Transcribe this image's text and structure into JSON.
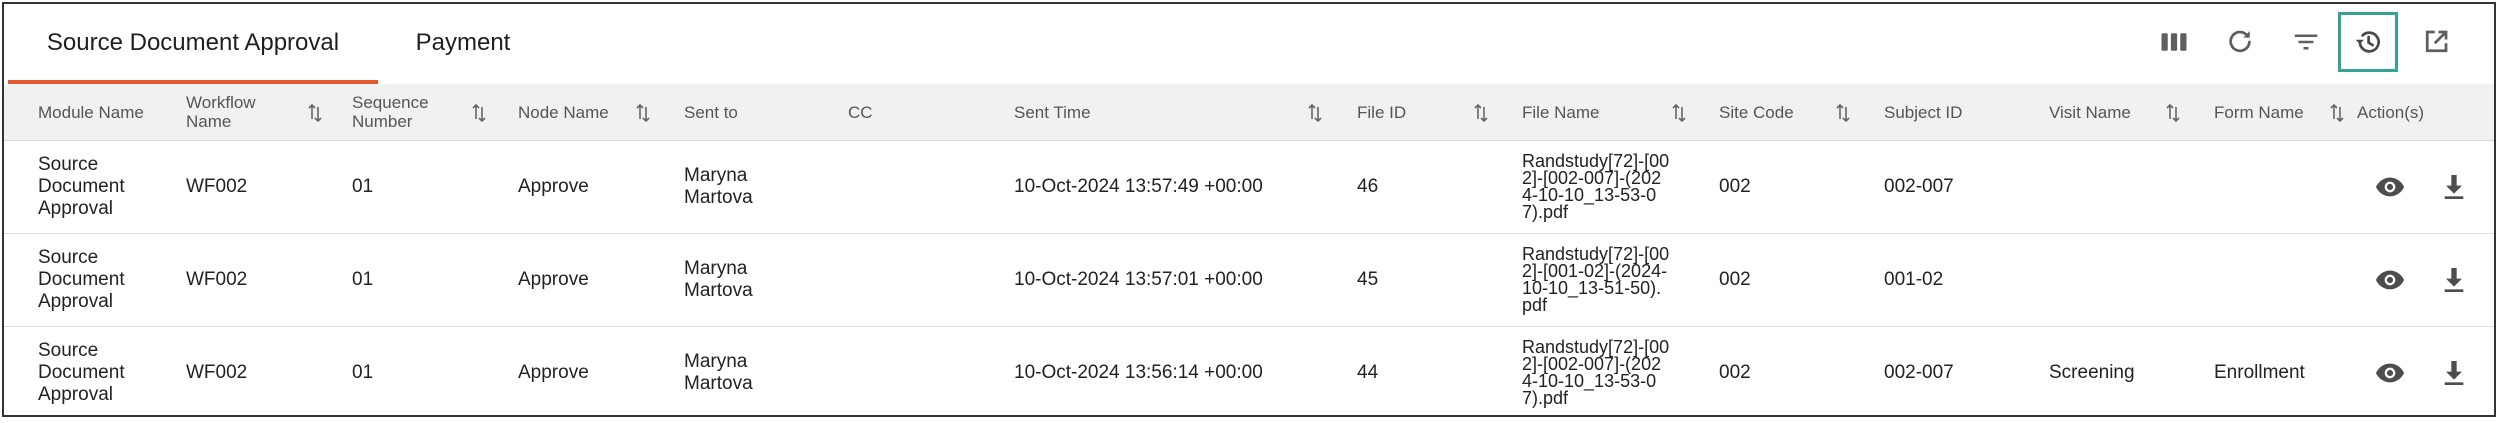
{
  "tabs": [
    {
      "label": "Source Document Approval",
      "active": true
    },
    {
      "label": "Payment",
      "active": false
    }
  ],
  "toolbar": {
    "icons": [
      "columns-icon",
      "refresh-icon",
      "filter-icon",
      "history-icon",
      "open-external-icon"
    ],
    "selected": "history-icon",
    "selected_color": "#36a392"
  },
  "accent_color": "#e2592f",
  "table": {
    "headers": [
      "Module Name",
      "Workflow Name",
      "Sequence Number",
      "Node Name",
      "Sent to",
      "CC",
      "Sent Time",
      "File ID",
      "File Name",
      "Site Code",
      "Subject ID",
      "Visit Name",
      "Form Name",
      "Action(s)"
    ],
    "rows": [
      {
        "module": "Source Document Approval",
        "workflow": "WF002",
        "sequence": "01",
        "node": "Approve",
        "sent_to": "Maryna Martova",
        "cc": "",
        "sent_time": "10-Oct-2024 13:57:49 +00:00",
        "file_id": "46",
        "file_name": "Randstudy[72]-[002]-[002-007]-(2024-10-10_13-53-07).pdf",
        "site_code": "002",
        "subject_id": "002-007",
        "visit": "",
        "form": ""
      },
      {
        "module": "Source Document Approval",
        "workflow": "WF002",
        "sequence": "01",
        "node": "Approve",
        "sent_to": "Maryna Martova",
        "cc": "",
        "sent_time": "10-Oct-2024 13:57:01 +00:00",
        "file_id": "45",
        "file_name": "Randstudy[72]-[002]-[001-02]-(2024-10-10_13-51-50).pdf",
        "site_code": "002",
        "subject_id": "001-02",
        "visit": "",
        "form": ""
      },
      {
        "module": "Source Document Approval",
        "workflow": "WF002",
        "sequence": "01",
        "node": "Approve",
        "sent_to": "Maryna Martova",
        "cc": "",
        "sent_time": "10-Oct-2024 13:56:14 +00:00",
        "file_id": "44",
        "file_name": "Randstudy[72]-[002]-[002-007]-(2024-10-10_13-53-07).pdf",
        "site_code": "002",
        "subject_id": "002-007",
        "visit": "Screening",
        "form": "Enrollment"
      }
    ],
    "actions": [
      "view-icon",
      "download-icon"
    ]
  }
}
